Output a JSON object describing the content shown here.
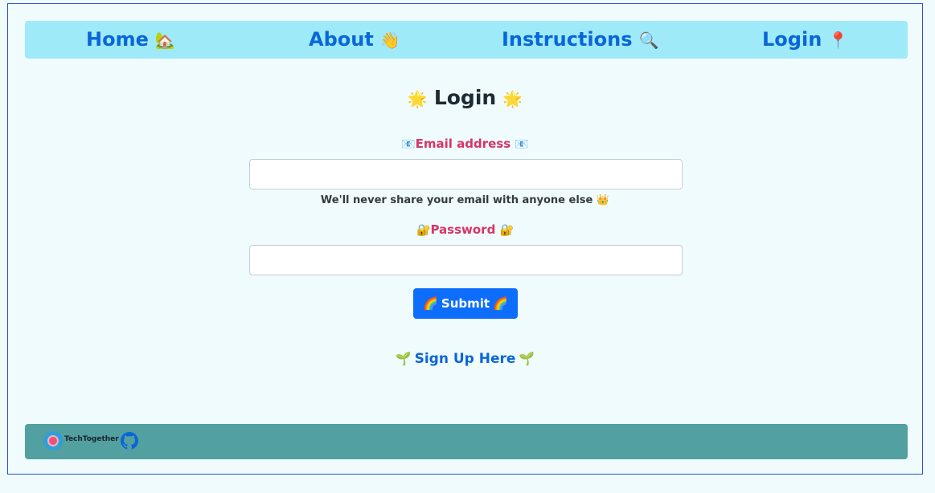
{
  "nav": {
    "items": [
      {
        "label": "Home",
        "emoji": "🏡"
      },
      {
        "label": "About",
        "emoji": "👋"
      },
      {
        "label": "Instructions",
        "emoji": "🔍"
      },
      {
        "label": "Login",
        "emoji": "📍"
      }
    ]
  },
  "form": {
    "title": "Login",
    "title_emoji": "🌟",
    "email_label": "Email address",
    "email_emoji": "📧",
    "email_value": "",
    "email_help": "We'll never share your email with anyone else",
    "email_help_emoji": "👑",
    "password_label": "Password",
    "password_emoji": "🔐",
    "password_value": "",
    "submit_label": "Submit",
    "submit_emoji": "🌈",
    "signup_label": "Sign Up Here",
    "signup_emoji": "🌱"
  },
  "footer": {
    "brand": "TechTogether",
    "github_icon": "github-icon"
  },
  "colors": {
    "nav_bg": "#9eeaf9",
    "link": "#0a66d8",
    "label": "#d63565",
    "button": "#0d6efd",
    "footer_bg": "#52a0a0",
    "page_bg": "#f0fbfe"
  }
}
